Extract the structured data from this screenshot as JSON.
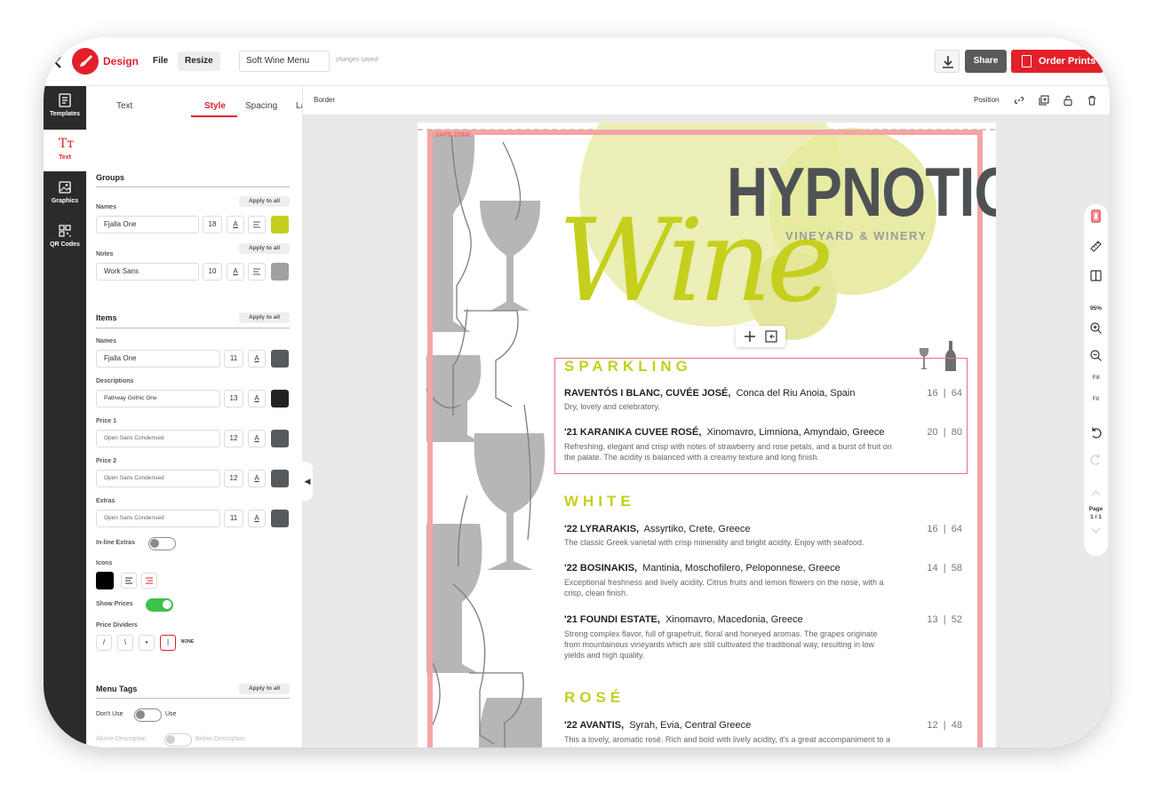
{
  "header": {
    "app_name": "Design",
    "menu_file": "File",
    "menu_resize": "Resize",
    "doc_name": "Soft Wine Menu",
    "save_status": "changes saved",
    "share_label": "Share",
    "order_label": "Order Prints",
    "accent": "#e3202a"
  },
  "sidebar": {
    "items": [
      {
        "label": "Templates",
        "icon": "templates-icon"
      },
      {
        "label": "Text",
        "icon": "text-icon"
      },
      {
        "label": "Graphics",
        "icon": "graphics-icon"
      },
      {
        "label": "QR Codes",
        "icon": "qr-code-icon"
      }
    ],
    "text_glyph": "Tт"
  },
  "panel": {
    "tabs": [
      "Text",
      "Style",
      "Spacing",
      "Layout"
    ],
    "active_tab": "Style",
    "apply_all": "Apply to all",
    "groups": {
      "title": "Groups",
      "names": {
        "label": "Names",
        "font": "Fjalla One",
        "size": "18",
        "color": "#c5cf1d"
      },
      "notes": {
        "label": "Notes",
        "font": "Work Sans",
        "size": "10",
        "color": "#a0a0a0"
      }
    },
    "items": {
      "title": "Items",
      "names": {
        "label": "Names",
        "font": "Fjalla One",
        "size": "11",
        "color": "#555a5e"
      },
      "descriptions": {
        "label": "Descriptions",
        "font": "Pathway Gothic One",
        "size": "13",
        "color": "#222222"
      },
      "price1": {
        "label": "Price 1",
        "font": "Open Sans Condensed",
        "size": "12",
        "color": "#555a5e"
      },
      "price2": {
        "label": "Price 2",
        "font": "Open Sans Condensed",
        "size": "12",
        "color": "#555a5e"
      },
      "extras": {
        "label": "Extras",
        "font": "Open Sans Condensed",
        "size": "11",
        "color": "#555a5e"
      }
    },
    "inline_extras": {
      "label": "In-line Extras",
      "on": false
    },
    "icons_label": "Icons",
    "icons_color": "#000000",
    "show_prices": {
      "label": "Show Prices",
      "on": true
    },
    "price_dividers": {
      "label": "Price Dividers",
      "options": [
        "/",
        "\\",
        "•",
        "|",
        "NONE"
      ],
      "selected": "|"
    },
    "menu_tags": {
      "title": "Menu Tags",
      "dont_use": "Don't Use",
      "use": "Use",
      "above": "Above Description",
      "below": "Below Description",
      "font": "Work Sans",
      "size": "10"
    },
    "underline_glyph": "A"
  },
  "canvas_toolbar": {
    "border_label": "Border",
    "position_label": "Position"
  },
  "rail": {
    "zoom": "95%",
    "fill": "Fill",
    "fit": "Fit",
    "page_label": "Page",
    "page_count": "1 / 1"
  },
  "menu": {
    "safe_zone": "SAFE ZONE",
    "brand_main": "HYPNOTIC",
    "brand_sub": "VINEYARD & WINERY",
    "brand_script": "Wine",
    "sections": [
      {
        "name": "SPARKLING",
        "items": [
          {
            "title": "RAVENTÓS I BLANC, CUVÉE JOSÉ,",
            "origin": "Conca del Riu Anoia, Spain",
            "desc": "Dry, lovely and celebratory.",
            "glass": "16",
            "bottle": "64"
          },
          {
            "title": "'21 KARANIKA CUVEE ROSÉ,",
            "origin": "Xinomavro, Limniona, Amyndaio, Greece",
            "desc": "Refreshing, elegant and crisp with notes of strawberry and rose petals, and a burst of fruit on the palate. The acidity is balanced with a creamy texture and long finish.",
            "glass": "20",
            "bottle": "80"
          }
        ]
      },
      {
        "name": "WHITE",
        "items": [
          {
            "title": "'22 LYRARAKIS,",
            "origin": "Assyrtiko, Crete, Greece",
            "desc": "The classic Greek varietal with crisp minerality and bright acidity. Enjoy with seafood.",
            "glass": "16",
            "bottle": "64"
          },
          {
            "title": "'22 BOSINAKIS,",
            "origin": "Mantinia, Moschofilero, Peloponnese, Greece",
            "desc": "Exceptional freshness and lively acidity. Citrus fruits and lemon flowers on the nose, with a crisp, clean finish.",
            "glass": "14",
            "bottle": "58"
          },
          {
            "title": "'21 FOUNDI ESTATE,",
            "origin": "Xinomavro, Macedonia, Greece",
            "desc": "Strong complex flavor, full of grapefruit, floral and honeyed aromas. The grapes originate from mountainous vineyards which are still cultivated the traditional way, resulting in low yields and high quality.",
            "glass": "13",
            "bottle": "52"
          }
        ]
      },
      {
        "name": "ROSÉ",
        "items": [
          {
            "title": "'22 AVANTIS,",
            "origin": "Syrah, Evia, Central Greece",
            "desc": "This a lovely, aromatic rosé. Rich and bold with lively acidity, it's a great accompaniment to a wide",
            "glass": "12",
            "bottle": "48"
          }
        ]
      }
    ],
    "price_sep": "|",
    "colors": {
      "lime": "#c5cf1d",
      "charcoal": "#4f5255",
      "glass_gray": "#b4b4b4",
      "safe_zone": "#f4a5a5"
    }
  }
}
